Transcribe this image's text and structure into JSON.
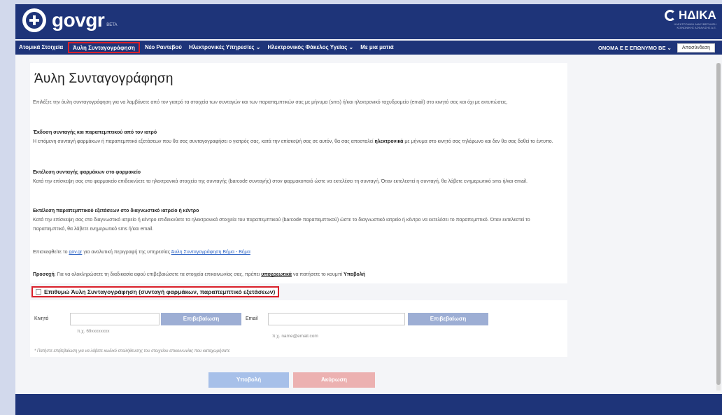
{
  "header": {
    "logo_text": "govgr",
    "logo_beta": "BETA",
    "brand": "ΗΔΙΚΑ",
    "brand_sub": "ΗΛΕΚΤΡΟΝΙΚΗ ΔΙΑΚΥΒΕΡΝΗΣΗ ΚΟΙΝΩΝΙΚΗΣ ΑΣΦΑΛΙΣΗΣ Α.Ε."
  },
  "nav": {
    "items": [
      "Ατομικά Στοιχεία",
      "Άυλη Συνταγογράφηση",
      "Νέο Ραντεβού",
      "Ηλεκτρονικές Υπηρεσίες ⌄",
      "Ηλεκτρονικός Φάκελος Υγείας ⌄",
      "Με μια ματιά"
    ],
    "user": "ΟΝΟΜΑ Ε Ε ΕΠΩΝΥΜΟ ΒΕ ⌄",
    "logout": "Αποσύνδεση"
  },
  "main": {
    "title": "Άυλη Συνταγογράφηση",
    "intro": "Επιλέξτε την άυλη συνταγογράφηση για να λαμβάνετε από τον γιατρό τα στοιχεία των συνταγών και των παραπεμπτικών σας με μήνυμα (sms) ή/και ηλεκτρονικό ταχυδρομείο (email) στο κινητό σας και όχι με εκτυπώσεις.",
    "s1_title": "Έκδοση συνταγής και παραπεμπτικού από τον ιατρό",
    "s1_text_a": "Η επόμενη συνταγή φαρμάκων ή παραπεμπτικό εξετάσεων που θα σας συνταγογραφήσει ο γιατρός σας, κατά την επίσκεψή σας σε αυτόν, θα σας αποσταλεί ",
    "s1_bold": "ηλεκτρονικά",
    "s1_text_b": " με μήνυμα στο κινητό σας τηλέφωνο και δεν θα σας δοθεί το έντυπο.",
    "s2_title": "Εκτέλεση συνταγής φαρμάκων στο φαρμακείο",
    "s2_text": "Κατά την επίσκεψη σας στο φαρμακείο επιδεικνύετε τα ηλεκτρονικά στοιχεία της συνταγής (barcode συνταγής) στον φαρμακοποιό ώστε να εκτελέσει τη συνταγή. Όταν εκτελεστεί η συνταγή, θα λάβετε ενημερωτικό sms ή/και email.",
    "s3_title": "Εκτέλεση παραπεμπτικού εξετάσεων στο διαγνωστικό ιατρείο ή κέντρο",
    "s3_text": "Κατά την επίσκεψη σας στο διαγνωστικό ιατρείο ή κέντρο επιδεικνύετε τα ηλεκτρονικά στοιχεία του παραπεμπτικού (barcode παραπεμπτικού) ώστε το διαγνωστικό ιατρείο ή κέντρο να εκτελέσει το παραπεμπτικό. Όταν εκτελεστεί το παραπεμπτικό, θα λάβετε ενημερωτικό sms ή/και email.",
    "visit_a": "Επισκεφθείτε το ",
    "visit_link1": "gov.gr",
    "visit_b": " για αναλυτική περιγραφή της υπηρεσίας ",
    "visit_link2": "Άυλη Συνταγογράφηση Βήμα - Βήμα",
    "attention_label": "Προσοχή",
    "attention_a": ": Για να ολοκληρώσετε τη διαδικασία αφού επιβεβαιώσετε τα στοιχεία επικοινωνίας σας, πρέπει ",
    "attention_bold": "υποχρεωτικά",
    "attention_b": " να πατήσετε το κουμπί ",
    "attention_btn": "Υποβολή"
  },
  "consent": {
    "label": "Επιθυμώ Άυλη Συνταγογράφηση (συνταγή φαρμάκων, παραπεμπτικό εξετάσεων)"
  },
  "form": {
    "mobile_label": "Κινητό",
    "mobile_value": "",
    "mobile_hint": "π.χ. 69xxxxxxxx",
    "verify_mobile": "Επιβεβαίωση",
    "email_label": "Email",
    "email_value": "",
    "email_hint": "π.χ. name@email.com",
    "verify_email": "Επιβεβαίωση",
    "note": "* Πατήστε επιβεβαίωση για να λάβετε κωδικό επαλήθευσης του στοιχείου επικοινωνίας που καταχωρήσατε"
  },
  "actions": {
    "submit": "Υποβολή",
    "cancel": "Ακύρωση"
  },
  "colors": {
    "primary": "#1e3479",
    "highlight": "#d9202a"
  }
}
